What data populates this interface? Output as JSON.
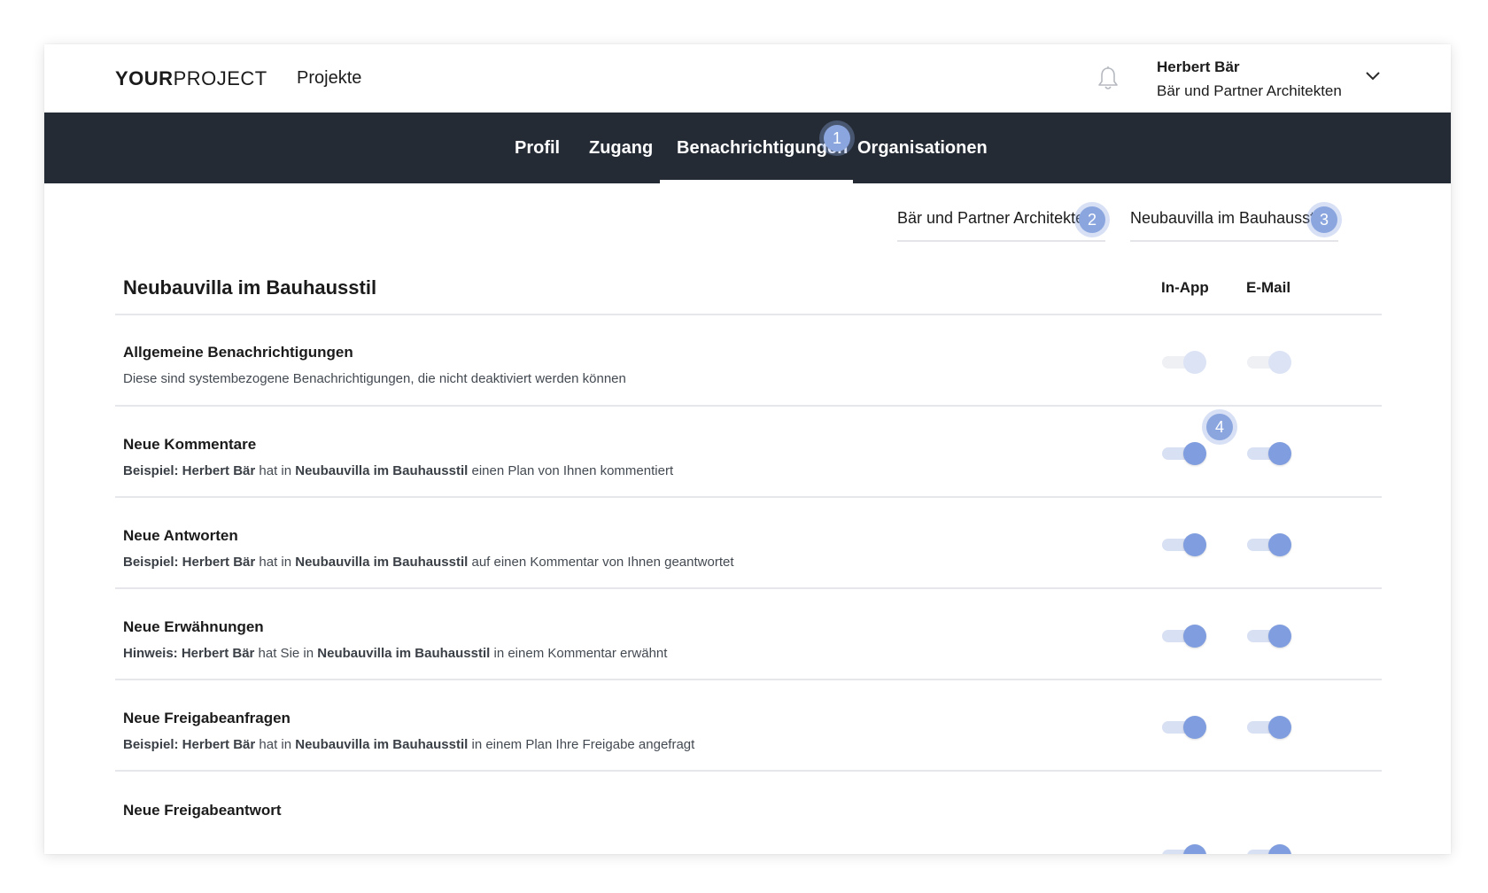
{
  "header": {
    "logo_bold": "YOUR",
    "logo_light": "PROJECT",
    "nav_projects": "Projekte",
    "user_name": "Herbert Bär",
    "user_org": "Bär und Partner Architekten"
  },
  "tabs": [
    {
      "label": "Profil"
    },
    {
      "label": "Zugang"
    },
    {
      "label": "Benachrichtigungen",
      "active": true
    },
    {
      "label": "Organisationen"
    }
  ],
  "badges": [
    "1",
    "2",
    "3",
    "4"
  ],
  "subtabs": [
    {
      "label": "Bär und Partner Architekten"
    },
    {
      "label": "Neubauvilla im Bauhausstil",
      "active": true
    }
  ],
  "section": {
    "title": "Neubauvilla im Bauhausstil",
    "col_inapp": "In-App",
    "col_email": "E-Mail"
  },
  "rows": [
    {
      "title": "Allgemeine Benachrichtigungen",
      "desc_plain": "Diese sind systembezogene Benachrichtigungen, die nicht deaktiviert werden können",
      "inapp": true,
      "email": true,
      "disabled": true
    },
    {
      "title": "Neue Kommentare",
      "d1": "Beispiel: Herbert Bär",
      "d2": " hat in ",
      "d3": "Neubauvilla im Bauhausstil",
      "d4": " einen Plan von Ihnen kommentiert",
      "inapp": true,
      "email": true
    },
    {
      "title": "Neue Antworten",
      "d1": "Beispiel: Herbert Bär",
      "d2": " hat in ",
      "d3": "Neubauvilla im Bauhausstil",
      "d4": " auf einen Kommentar von Ihnen geantwortet",
      "inapp": true,
      "email": true
    },
    {
      "title": "Neue Erwähnungen",
      "d1": "Hinweis: Herbert Bär",
      "d2": " hat Sie in ",
      "d3": "Neubauvilla im Bauhausstil",
      "d4": " in einem Kommentar erwähnt",
      "inapp": true,
      "email": true
    },
    {
      "title": "Neue Freigabeanfragen",
      "d1": "Beispiel: Herbert Bär",
      "d2": " hat in ",
      "d3": "Neubauvilla im Bauhausstil",
      "d4": " in einem Plan Ihre Freigabe angefragt",
      "inapp": true,
      "email": true
    },
    {
      "title": "Neue Freigabeantwort",
      "inapp": true,
      "email": true
    }
  ],
  "colors": {
    "tabbar_bg": "#242b35",
    "accent": "#7f9ddf",
    "badge": "#8ba6df"
  },
  "icons": [
    "bell-icon",
    "chevron-down-icon"
  ]
}
